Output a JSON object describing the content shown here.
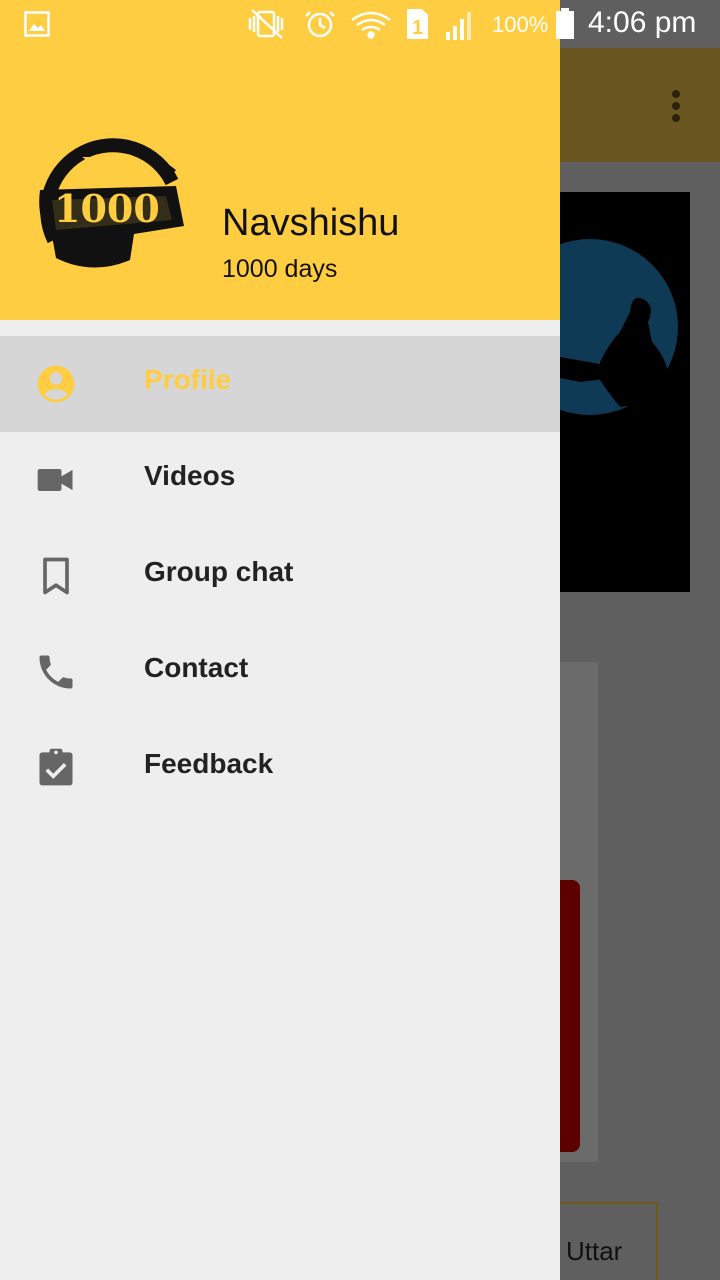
{
  "status_bar": {
    "battery_percent": "100%",
    "time": "4:06 pm",
    "icons": [
      "gallery-icon",
      "vibrate-off-icon",
      "alarm-icon",
      "wifi-icon",
      "sim-1-icon",
      "signal-icon",
      "battery-icon"
    ]
  },
  "drawer": {
    "header": {
      "logo_icon": "1000-days-logo",
      "logo_text_top": "DAYS",
      "logo_text_main": "1000",
      "name": "Navshishu",
      "subtitle": "1000 days",
      "background_color": "#ffcd41"
    },
    "menu": [
      {
        "label": "Profile",
        "icon": "account-circle-icon",
        "selected": true
      },
      {
        "label": "Videos",
        "icon": "videocam-icon",
        "selected": false
      },
      {
        "label": "Group chat",
        "icon": "bookmark-icon",
        "selected": false
      },
      {
        "label": "Contact",
        "icon": "phone-icon",
        "selected": false
      },
      {
        "label": "Feedback",
        "icon": "assignment-check-icon",
        "selected": false
      }
    ],
    "accent_color": "#ffcd41"
  },
  "background_app": {
    "partial_button_label": "Uttar",
    "overflow_icon": "more-vert-icon"
  }
}
